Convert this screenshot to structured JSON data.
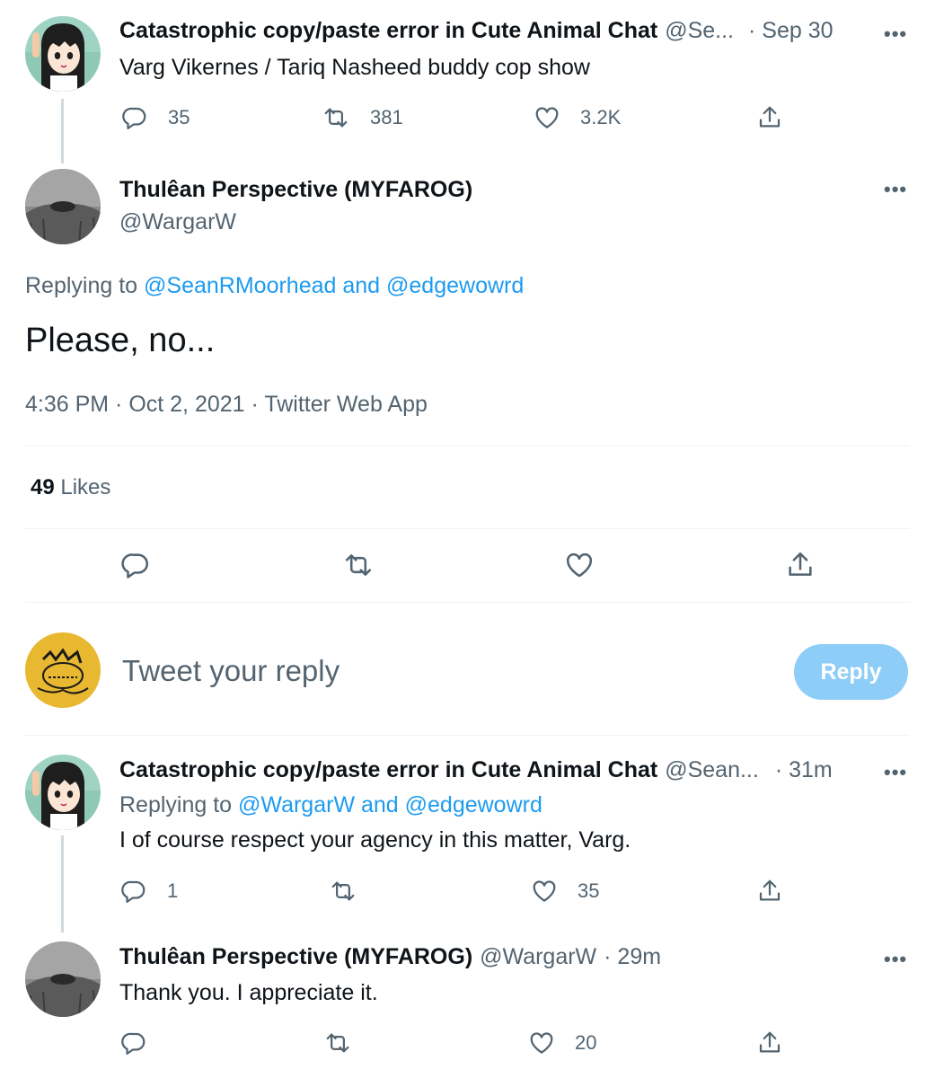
{
  "tweet1": {
    "name": "Catastrophic copy/paste error in Cute Animal Chat",
    "handle": "@Se...",
    "time": "· Sep 30",
    "text": "Varg Vikernes / Tariq Nasheed buddy cop show",
    "replies": "35",
    "retweets": "381",
    "likes": "3.2K"
  },
  "main": {
    "name": "Thulêan Perspective (MYFAROG)",
    "handle": "@WargarW",
    "replying_prefix": "Replying to",
    "replying_users": "@SeanRMoorhead and @edgewowrd",
    "text": "Please, no...",
    "timestamp": "4:36 PM · Oct 2, 2021 · Twitter Web App",
    "likes_count": "49",
    "likes_label": "Likes"
  },
  "compose": {
    "placeholder": "Tweet your reply",
    "button": "Reply"
  },
  "reply1": {
    "name": "Catastrophic copy/paste error in Cute Animal Chat",
    "handle": "@Sean...",
    "time": "· 31m",
    "replying_prefix": "Replying to",
    "replying_users": "@WargarW and @edgewowrd",
    "text": "I of course respect your agency in this matter, Varg.",
    "replies": "1",
    "likes": "35"
  },
  "reply2": {
    "name": "Thulêan Perspective (MYFAROG)",
    "handle": "@WargarW",
    "time": "· 29m",
    "text": "Thank you. I appreciate it.",
    "likes": "20"
  },
  "icons": {
    "more": "•••",
    "reply": "reply-icon",
    "retweet": "retweet-icon",
    "like": "heart-icon",
    "share": "share-icon"
  },
  "colors": {
    "accent": "#1d9bf0",
    "secondary_text": "#536471",
    "reply_button": "#8ecdf8"
  }
}
